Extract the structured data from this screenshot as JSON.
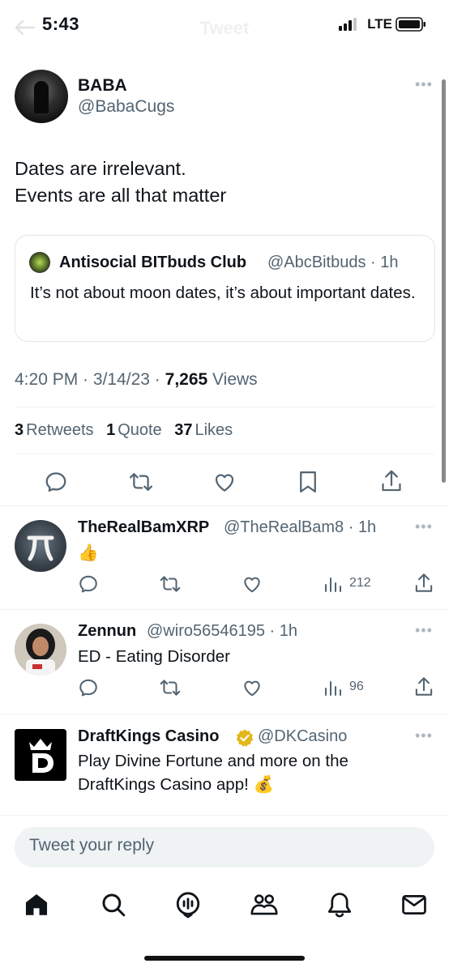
{
  "status_bar": {
    "time": "5:43",
    "network": "LTE"
  },
  "header": {
    "title": "Tweet"
  },
  "tweet": {
    "author_name": "BABA",
    "author_handle": "@BabaCugs",
    "text_line1": "Dates are irrelevant.",
    "text_line2": "Events are all that matter",
    "quote": {
      "author_name": "Antisocial BITbuds Club",
      "author_handle": "@AbcBitbuds",
      "age": "1h",
      "text": "It’s not about moon dates, it’s about important dates."
    },
    "time": "4:20 PM",
    "date": "3/14/23",
    "views_count": "7,265",
    "views_label": "Views",
    "retweets_count": "3",
    "retweets_label": "Retweets",
    "quotes_count": "1",
    "quotes_label": "Quote",
    "likes_count": "37",
    "likes_label": "Likes"
  },
  "replies": [
    {
      "name": "TheRealBamXRP",
      "handle": "@TheRealBam8",
      "age": "1h",
      "text": "👍",
      "views": "212"
    },
    {
      "name": "Zennun",
      "handle": "@wiro56546195",
      "age": "1h",
      "text": "ED - Eating Disorder",
      "views": "96"
    }
  ],
  "ad": {
    "name": "DraftKings Casino",
    "handle": "@DKCasino",
    "text_line1": "Play Divine Fortune and more on the",
    "text_line2": "DraftKings Casino app! 💰"
  },
  "reply_bar": {
    "placeholder": "Tweet your reply"
  },
  "colors": {
    "text": "#0f1419",
    "secondary": "#536471",
    "divider": "#eff3f4",
    "verified": "#e2b719"
  },
  "icons": [
    "home-icon",
    "search-icon",
    "spaces-icon",
    "communities-icon",
    "notifications-icon",
    "messages-icon",
    "reply-icon",
    "retweet-icon",
    "like-icon",
    "bookmark-icon",
    "share-icon",
    "views-icon"
  ]
}
